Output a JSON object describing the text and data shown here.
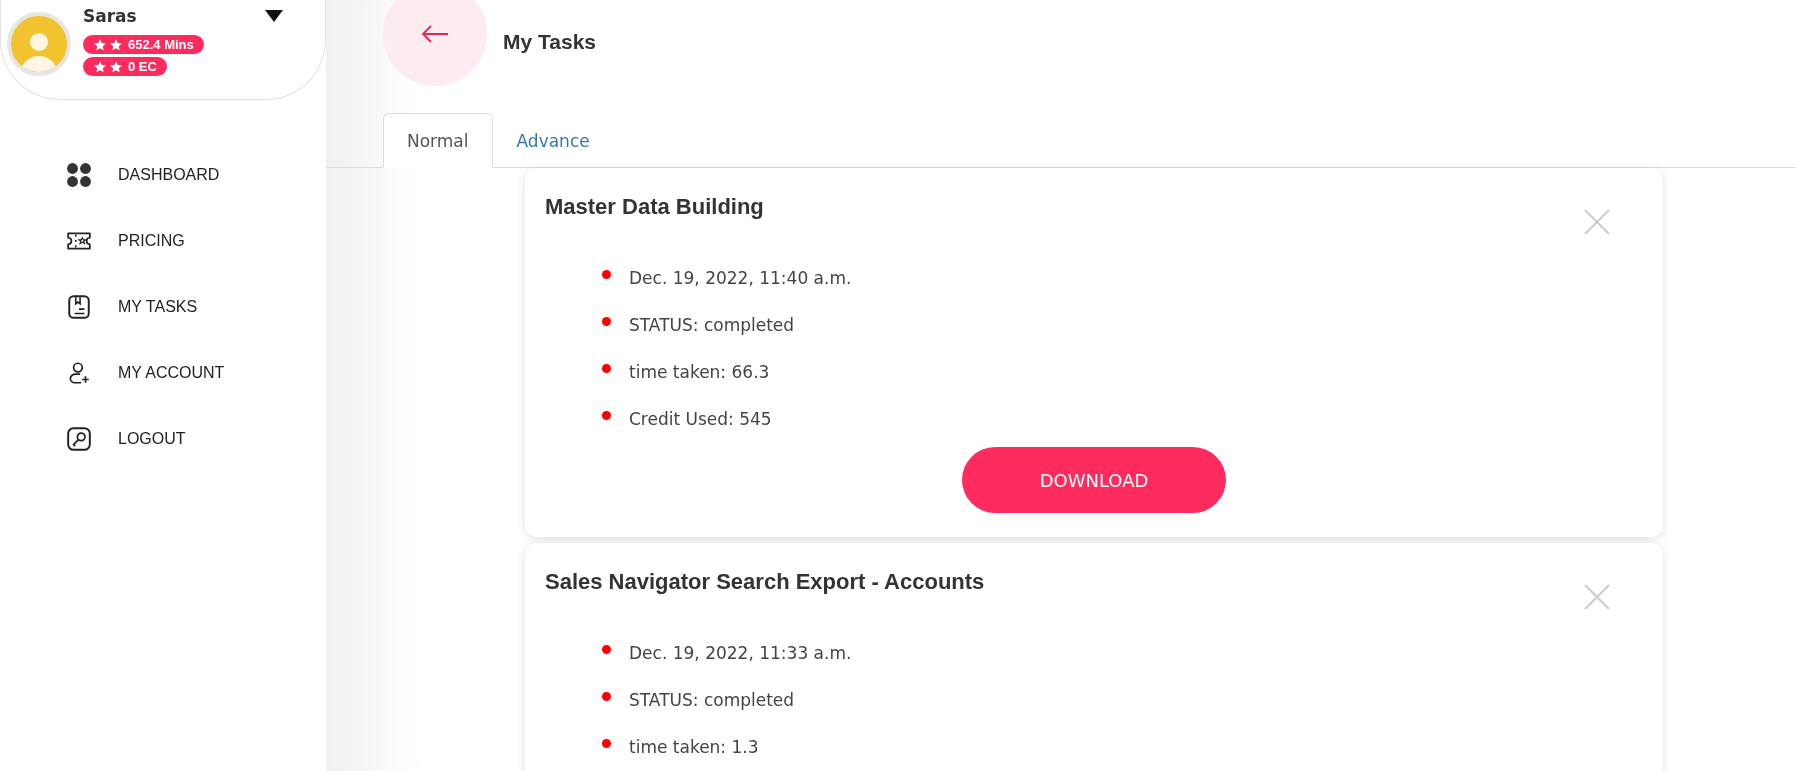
{
  "user": {
    "name": "Saras",
    "badges": [
      {
        "text": "652.4 Mins"
      },
      {
        "text": "0 EC"
      }
    ]
  },
  "nav": [
    {
      "label": "DASHBOARD",
      "kind": "grid"
    },
    {
      "label": "PRICING",
      "kind": "ticket"
    },
    {
      "label": "MY TASKS",
      "kind": "tasks"
    },
    {
      "label": "MY ACCOUNT",
      "kind": "account"
    },
    {
      "label": "LOGOUT",
      "kind": "key"
    }
  ],
  "page_title": "My Tasks",
  "tabs": [
    {
      "label": "Normal",
      "selected": true
    },
    {
      "label": "Advance",
      "selected": false
    }
  ],
  "tasks": [
    {
      "title": "Master Data Building",
      "details": [
        "Dec. 19, 2022, 11:40 a.m.",
        "STATUS: completed",
        "time taken: 66.3",
        "Credit Used: 545"
      ],
      "button": "DOWNLOAD"
    },
    {
      "title": "Sales Navigator Search Export - Accounts",
      "details": [
        "Dec. 19, 2022, 11:33 a.m.",
        "STATUS: completed",
        "time taken: 1.3"
      ]
    }
  ]
}
